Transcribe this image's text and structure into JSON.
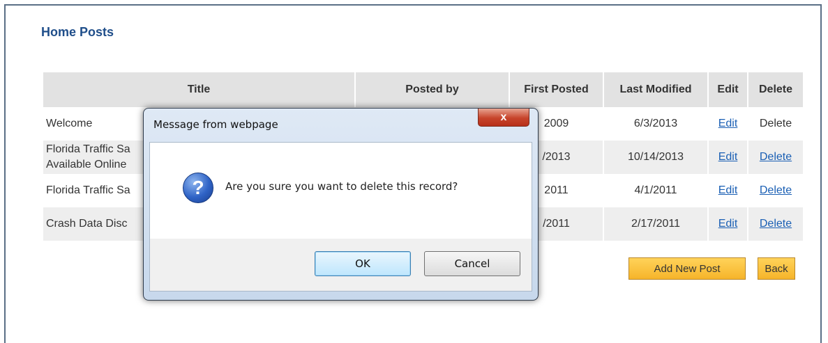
{
  "page": {
    "title": "Home Posts"
  },
  "table": {
    "headers": [
      "Title",
      "Posted by",
      "First Posted",
      "Last Modified",
      "Edit",
      "Delete"
    ],
    "rows": [
      {
        "title": "Welcome",
        "posted_by": "",
        "first_posted": "2009",
        "last_modified": "6/3/2013",
        "edit": "Edit",
        "delete": "Delete",
        "delete_is_link": false
      },
      {
        "title": "Florida Traffic Sa\nAvailable Online",
        "posted_by": "",
        "first_posted": "/2013",
        "last_modified": "10/14/2013",
        "edit": "Edit",
        "delete": "Delete",
        "delete_is_link": true
      },
      {
        "title": "Florida Traffic Sa",
        "posted_by": "",
        "first_posted": "2011",
        "last_modified": "4/1/2011",
        "edit": "Edit",
        "delete": "Delete",
        "delete_is_link": true
      },
      {
        "title": "Crash Data Disc",
        "posted_by": "",
        "first_posted": "/2011",
        "last_modified": "2/17/2011",
        "edit": "Edit",
        "delete": "Delete",
        "delete_is_link": true
      }
    ]
  },
  "buttons": {
    "add_new_post": "Add New Post",
    "back": "Back"
  },
  "dialog": {
    "title": "Message from webpage",
    "close_label": "x",
    "icon": "question-icon",
    "message": "Are you sure you want to delete this record?",
    "ok_label": "OK",
    "cancel_label": "Cancel"
  }
}
